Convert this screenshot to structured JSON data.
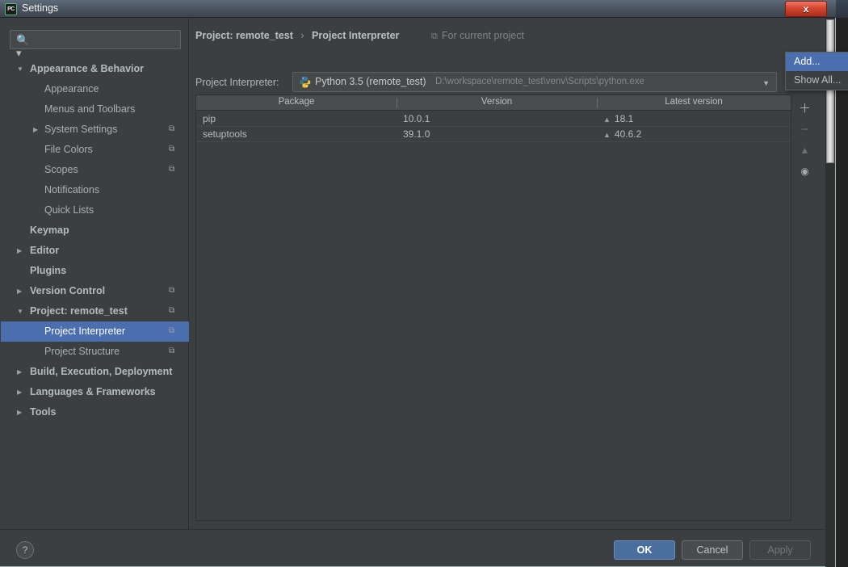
{
  "window": {
    "title": "Settings",
    "app_icon": "pycharm-icon",
    "close_label": "x"
  },
  "sidebar": {
    "search": {
      "placeholder": "",
      "value": "",
      "icon": "search-icon"
    },
    "items": [
      {
        "label": "Appearance & Behavior",
        "level": 0,
        "bold": true,
        "arrow": "▼",
        "badge": ""
      },
      {
        "label": "Appearance",
        "level": 1,
        "bold": false,
        "arrow": "",
        "badge": ""
      },
      {
        "label": "Menus and Toolbars",
        "level": 1,
        "bold": false,
        "arrow": "",
        "badge": ""
      },
      {
        "label": "System Settings",
        "level": 1,
        "bold": false,
        "arrow": "▶",
        "badge": "⧉"
      },
      {
        "label": "File Colors",
        "level": 1,
        "bold": false,
        "arrow": "",
        "badge": "⧉"
      },
      {
        "label": "Scopes",
        "level": 1,
        "bold": false,
        "arrow": "",
        "badge": "⧉"
      },
      {
        "label": "Notifications",
        "level": 1,
        "bold": false,
        "arrow": "",
        "badge": ""
      },
      {
        "label": "Quick Lists",
        "level": 1,
        "bold": false,
        "arrow": "",
        "badge": ""
      },
      {
        "label": "Keymap",
        "level": 0,
        "bold": true,
        "arrow": "",
        "badge": ""
      },
      {
        "label": "Editor",
        "level": 0,
        "bold": true,
        "arrow": "▶",
        "badge": ""
      },
      {
        "label": "Plugins",
        "level": 0,
        "bold": true,
        "arrow": "",
        "badge": ""
      },
      {
        "label": "Version Control",
        "level": 0,
        "bold": true,
        "arrow": "▶",
        "badge": "⧉"
      },
      {
        "label": "Project: remote_test",
        "level": 0,
        "bold": true,
        "arrow": "▼",
        "badge": "⧉"
      },
      {
        "label": "Project Interpreter",
        "level": 1,
        "bold": false,
        "arrow": "",
        "badge": "⧉",
        "selected": true
      },
      {
        "label": "Project Structure",
        "level": 1,
        "bold": false,
        "arrow": "",
        "badge": "⧉"
      },
      {
        "label": "Build, Execution, Deployment",
        "level": 0,
        "bold": true,
        "arrow": "▶",
        "badge": ""
      },
      {
        "label": "Languages & Frameworks",
        "level": 0,
        "bold": true,
        "arrow": "▶",
        "badge": ""
      },
      {
        "label": "Tools",
        "level": 0,
        "bold": true,
        "arrow": "▶",
        "badge": ""
      }
    ]
  },
  "main": {
    "breadcrumb": {
      "parent": "Project: remote_test",
      "separator": "›",
      "current": "Project Interpreter"
    },
    "scope_note": {
      "icon": "copy-badge-icon",
      "label": "For current project"
    },
    "interpreter": {
      "field_label": "Project Interpreter:",
      "icon": "python-remote-icon",
      "name": "Python 3.5 (remote_test)",
      "path": "D:\\workspace\\remote_test\\venv\\Scripts\\python.exe",
      "arrow": "▼"
    },
    "dropdown_menu": {
      "items": [
        {
          "label": "Add...",
          "highlighted": true
        },
        {
          "label": "Show All...",
          "highlighted": false
        }
      ]
    },
    "packages_table": {
      "columns": [
        "Package",
        "Version",
        "Latest version"
      ],
      "rows": [
        {
          "package": "pip",
          "version": "10.0.1",
          "latest": "18.1",
          "upgrade_marker": "▲"
        },
        {
          "package": "setuptools",
          "version": "39.1.0",
          "latest": "40.6.2",
          "upgrade_marker": "▲"
        }
      ]
    },
    "table_toolbar": [
      {
        "icon": "plus-icon",
        "glyph": "＋",
        "enabled": true
      },
      {
        "icon": "minus-icon",
        "glyph": "−",
        "enabled": false
      },
      {
        "icon": "upgrade-arrow-icon",
        "glyph": "▲",
        "enabled": false
      },
      {
        "icon": "eye-icon",
        "glyph": "◉",
        "enabled": true
      }
    ]
  },
  "footer": {
    "help_label": "?",
    "ok_label": "OK",
    "cancel_label": "Cancel",
    "apply_label": "Apply"
  },
  "colors": {
    "background": "#3c3f41",
    "selection": "#4b6eaf",
    "primary_button": "#4a6f9e",
    "text": "#b0b6b9",
    "muted_text": "#85898b"
  }
}
